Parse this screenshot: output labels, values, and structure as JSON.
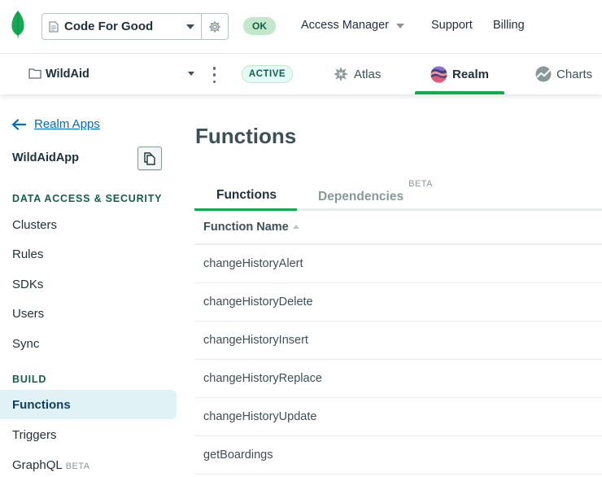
{
  "topbar": {
    "org_name": "Code For Good",
    "status_badge": "OK",
    "links": [
      "Access Manager",
      "Support",
      "Billing"
    ]
  },
  "projectbar": {
    "project_name": "WildAid",
    "status_badge": "ACTIVE",
    "product_tabs": [
      "Atlas",
      "Realm",
      "Charts"
    ],
    "selected_tab": "Realm"
  },
  "sidebar": {
    "back_label": "Realm Apps",
    "app_name": "WildAidApp",
    "section_data": "DATA ACCESS & SECURITY",
    "data_items": [
      "Clusters",
      "Rules",
      "SDKs",
      "Users",
      "Sync"
    ],
    "section_build": "BUILD",
    "build_items": [
      "Functions",
      "Triggers",
      "GraphQL"
    ],
    "graphql_badge": "BETA",
    "selected_item": "Functions"
  },
  "main": {
    "title": "Functions",
    "tabs": [
      {
        "label": "Functions",
        "badge": ""
      },
      {
        "label": "Dependencies",
        "badge": "BETA"
      }
    ],
    "table": {
      "header": "Function Name",
      "rows": [
        "changeHistoryAlert",
        "changeHistoryDelete",
        "changeHistoryInsert",
        "changeHistoryReplace",
        "changeHistoryUpdate",
        "getBoardings"
      ]
    }
  },
  "colors": {
    "brand_green": "#13aa52",
    "link_blue": "#006cbc",
    "selected_nav_bg": "#e1f2f6",
    "section_heading": "#116149"
  },
  "icons": [
    "leaf-logo-icon",
    "document-icon",
    "gear-icon",
    "folder-icon",
    "kebab-icon",
    "atlas-icon",
    "realm-icon",
    "charts-icon",
    "arrow-left-icon",
    "copy-icon",
    "sort-ascending-icon"
  ]
}
